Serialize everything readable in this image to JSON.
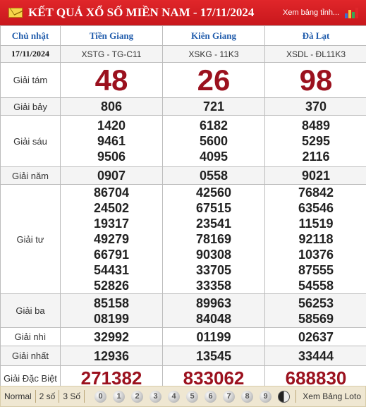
{
  "header": {
    "title": "KẾT QUẢ XỔ SỐ MIỀN NAM - 17/11/2024",
    "xem_link": "Xem bảng tỉnh...",
    "bar_colors": [
      "#3b6fd1",
      "#f2c23a",
      "#35a853",
      "#e0262a"
    ]
  },
  "table": {
    "day": "Chủ nhật",
    "date": "17/11/2024",
    "provinces": [
      "Tiền Giang",
      "Kiên Giang",
      "Đà Lạt"
    ],
    "codes": [
      "XSTG - TG-C11",
      "XSKG - 11K3",
      "XSDL - ĐL11K3"
    ],
    "labels": {
      "g8": "Giải tám",
      "g7": "Giải bảy",
      "g6": "Giải sáu",
      "g5": "Giải năm",
      "g4": "Giải tư",
      "g3": "Giải ba",
      "g2": "Giải nhì",
      "g1": "Giải nhất",
      "db": "Giải Đặc Biệt"
    },
    "g8": [
      "48",
      "26",
      "98"
    ],
    "g7": [
      "806",
      "721",
      "370"
    ],
    "g6": [
      [
        "1420",
        "9461",
        "9506"
      ],
      [
        "6182",
        "5600",
        "4095"
      ],
      [
        "8489",
        "5295",
        "2116"
      ]
    ],
    "g5": [
      "0907",
      "0558",
      "9021"
    ],
    "g4": [
      [
        "86704",
        "24502",
        "19317",
        "49279",
        "66791",
        "54431",
        "52826"
      ],
      [
        "42560",
        "67515",
        "23541",
        "78169",
        "90308",
        "33705",
        "33358"
      ],
      [
        "76842",
        "63546",
        "11519",
        "92118",
        "10376",
        "87555",
        "54558"
      ]
    ],
    "g3": [
      [
        "85158",
        "08199"
      ],
      [
        "89963",
        "84048"
      ],
      [
        "56253",
        "58569"
      ]
    ],
    "g2": [
      "32992",
      "01199",
      "02637"
    ],
    "g1": [
      "12936",
      "13545",
      "33444"
    ],
    "db": [
      "271382",
      "833062",
      "688830"
    ]
  },
  "footer": {
    "normal": "Normal",
    "two": "2 số",
    "three": "3 Số",
    "digits": [
      "0",
      "1",
      "2",
      "3",
      "4",
      "5",
      "6",
      "7",
      "8",
      "9"
    ],
    "loto": "Xem Bảng Loto"
  }
}
